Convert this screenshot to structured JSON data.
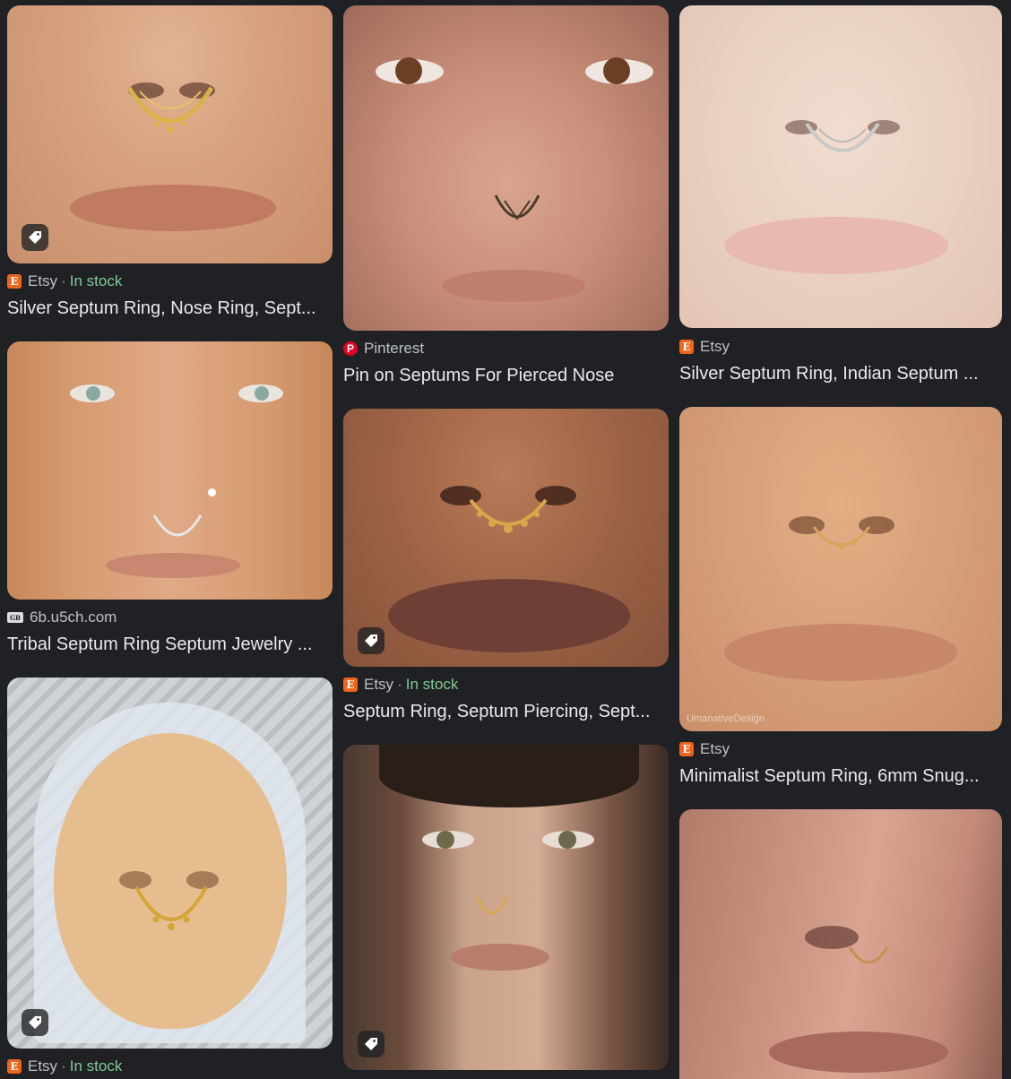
{
  "results": [
    {
      "source": "Etsy",
      "in_stock": "In stock",
      "title": "Silver Septum Ring, Nose Ring, Sept...",
      "icon": "etsy-icon",
      "has_tag": true
    },
    {
      "source": "6b.u5ch.com",
      "in_stock": "",
      "title": "Tribal Septum Ring Septum Jewelry ...",
      "icon": "site-icon",
      "has_tag": false
    },
    {
      "source": "Etsy",
      "in_stock": "In stock",
      "title": "",
      "icon": "etsy-icon",
      "has_tag": true
    },
    {
      "source": "Pinterest",
      "in_stock": "",
      "title": "Pin on Septums For Pierced Nose",
      "icon": "pinterest-icon",
      "has_tag": false
    },
    {
      "source": "Etsy",
      "in_stock": "In stock",
      "title": "Septum Ring, Septum Piercing, Sept...",
      "icon": "etsy-icon",
      "has_tag": true
    },
    {
      "source": "",
      "in_stock": "",
      "title": "",
      "icon": "",
      "has_tag": true
    },
    {
      "source": "Etsy",
      "in_stock": "",
      "title": "Silver Septum Ring, Indian Septum ...",
      "icon": "etsy-icon",
      "has_tag": false
    },
    {
      "source": "Etsy",
      "in_stock": "",
      "title": "Minimalist Septum Ring, 6mm Snug...",
      "icon": "etsy-icon",
      "has_tag": false
    },
    {
      "source": "",
      "in_stock": "",
      "title": "",
      "icon": "",
      "has_tag": false
    }
  ],
  "separator": "·",
  "watermark": "UmanativeDesign",
  "colors": {
    "background": "#202124",
    "in_stock": "#81c995",
    "etsy": "#f1641e",
    "pinterest": "#e60023"
  }
}
